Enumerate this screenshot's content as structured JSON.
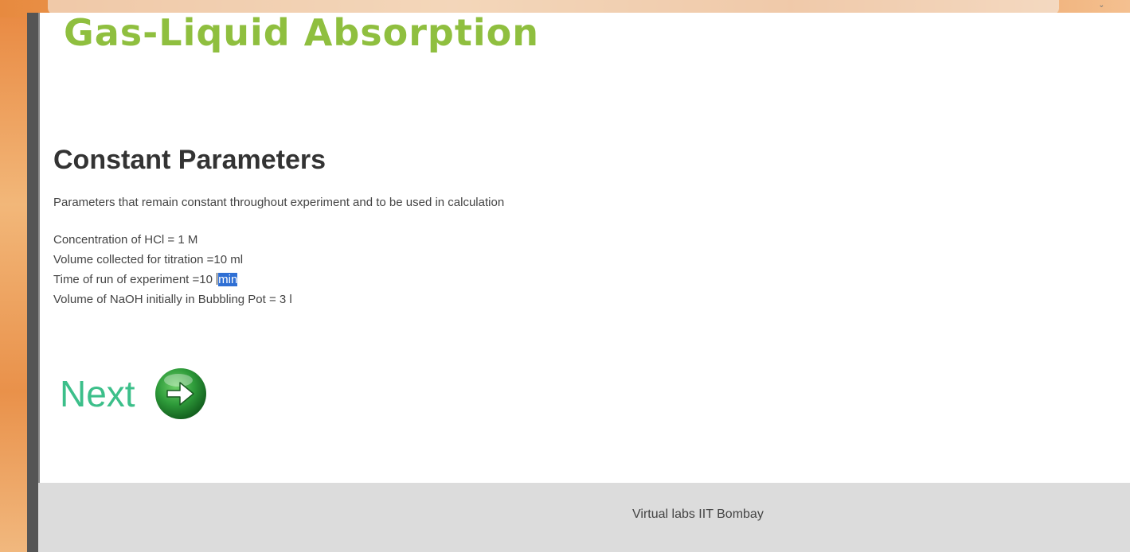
{
  "app": {
    "title": "Gas-Liquid Absorption"
  },
  "section": {
    "heading": "Constant Parameters",
    "description": "Parameters that remain constant throughout experiment and to be used in calculation"
  },
  "parameters": [
    {
      "text": "Concentration of HCl = 1 M"
    },
    {
      "text": "Volume collected for titration =10 ml"
    },
    {
      "text_before": "Time of run of experiment =10 ",
      "selected": "min"
    },
    {
      "text": "Volume of NaOH initially in Bubbling Pot = 3 l"
    }
  ],
  "navigation": {
    "next_label": "Next",
    "next_icon": "arrow-right-circle-icon"
  },
  "footer": {
    "text": "Virtual labs IIT Bombay"
  },
  "colors": {
    "title_green": "#8fbf3f",
    "next_green": "#3cbf8a",
    "icon_green": "#2e9b3a",
    "footer_bg": "#dcdcdc",
    "selection_blue": "#2f6fd4"
  }
}
